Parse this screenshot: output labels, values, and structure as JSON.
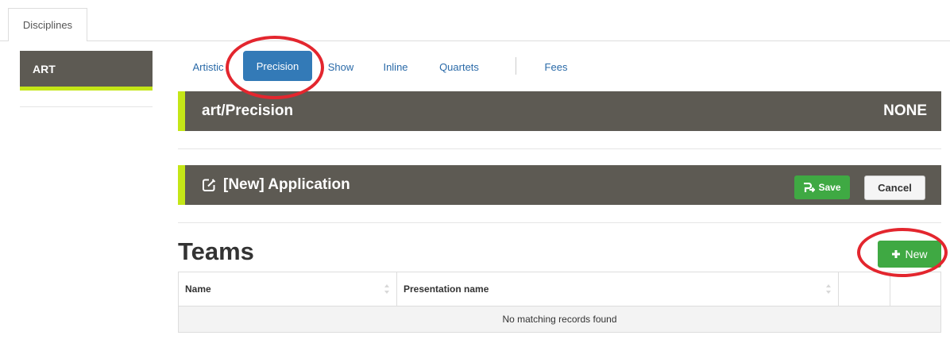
{
  "top_tabs": [
    {
      "label": "Disciplines"
    }
  ],
  "sidebar": {
    "items": [
      {
        "label": "ART"
      }
    ]
  },
  "discipline_tabs": [
    {
      "label": "Artistic"
    },
    {
      "label": "Precision",
      "active": true
    },
    {
      "label": "Show"
    },
    {
      "label": "Inline"
    },
    {
      "label": "Quartets"
    },
    {
      "label": "Fees"
    }
  ],
  "section_header": {
    "title": "art/Precision",
    "status": "NONE"
  },
  "application": {
    "title": "[New] Application",
    "save_label": "Save",
    "cancel_label": "Cancel",
    "icon": "edit-icon"
  },
  "teams": {
    "title": "Teams",
    "new_label": "New",
    "columns": [
      "Name",
      "Presentation name",
      "",
      ""
    ],
    "empty_message": "No matching records found"
  },
  "colors": {
    "accent": "#c4e617",
    "header_bg": "#5d5a53",
    "primary": "#337ab7",
    "success": "#3fa943",
    "annotation": "#e3262e"
  }
}
